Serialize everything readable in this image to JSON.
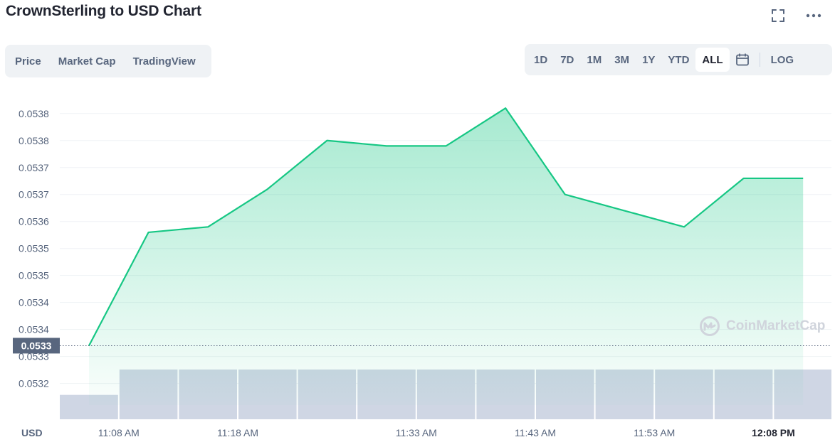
{
  "header": {
    "title": "CrownSterling to USD Chart"
  },
  "tabs_left": [
    "Price",
    "Market Cap",
    "TradingView"
  ],
  "ranges": [
    "1D",
    "7D",
    "1M",
    "3M",
    "1Y",
    "YTD",
    "ALL"
  ],
  "active_range": "ALL",
  "log_label": "LOG",
  "watermark": "CoinMarketCap",
  "colors": {
    "line": "#16c784",
    "fill": "#16c784",
    "volume": "#cfd6e4",
    "grid": "#eff2f5",
    "text": "#58667e",
    "price_tag_bg": "#58667e"
  },
  "icons": [
    "fullscreen-icon",
    "more-icon",
    "calendar-icon",
    "coinmarketcap-logo-icon"
  ],
  "chart_data": {
    "type": "area",
    "title": "CrownSterling to USD Chart",
    "currency_label": "USD",
    "current_price_label": "0.0533",
    "series": [
      {
        "values": [
          0.0533,
          0.05351,
          0.05352,
          0.05359,
          0.05368,
          0.05367,
          0.05367,
          0.05374,
          0.05358,
          0.05355,
          0.05352,
          0.05361,
          0.05361
        ]
      }
    ],
    "ylim": [
      0.05319,
      0.05376
    ],
    "y_ticks": [
      0.05373,
      0.05368,
      0.05363,
      0.05358,
      0.05353,
      0.05348,
      0.05343,
      0.05338,
      0.05333,
      0.05328,
      0.05323
    ],
    "y_tick_labels": [
      "0.0538",
      "0.0538",
      "0.0537",
      "0.0537",
      "0.0536",
      "0.0535",
      "0.0535",
      "0.0534",
      "0.0534",
      "0.0533",
      "0.0532"
    ],
    "x_tick_labels": [
      "11:08 AM",
      "11:18 AM",
      "11:33 AM",
      "11:43 AM",
      "11:53 AM",
      "12:08 PM"
    ],
    "x_tick_indices": [
      0.5,
      2.5,
      5.5,
      7.5,
      9.5,
      11.5
    ],
    "bold_x_tick": "12:08 PM",
    "volume": [
      0.49,
      1,
      1,
      1,
      1,
      1,
      1,
      1,
      1,
      1,
      1,
      1,
      1
    ],
    "grid": true
  }
}
